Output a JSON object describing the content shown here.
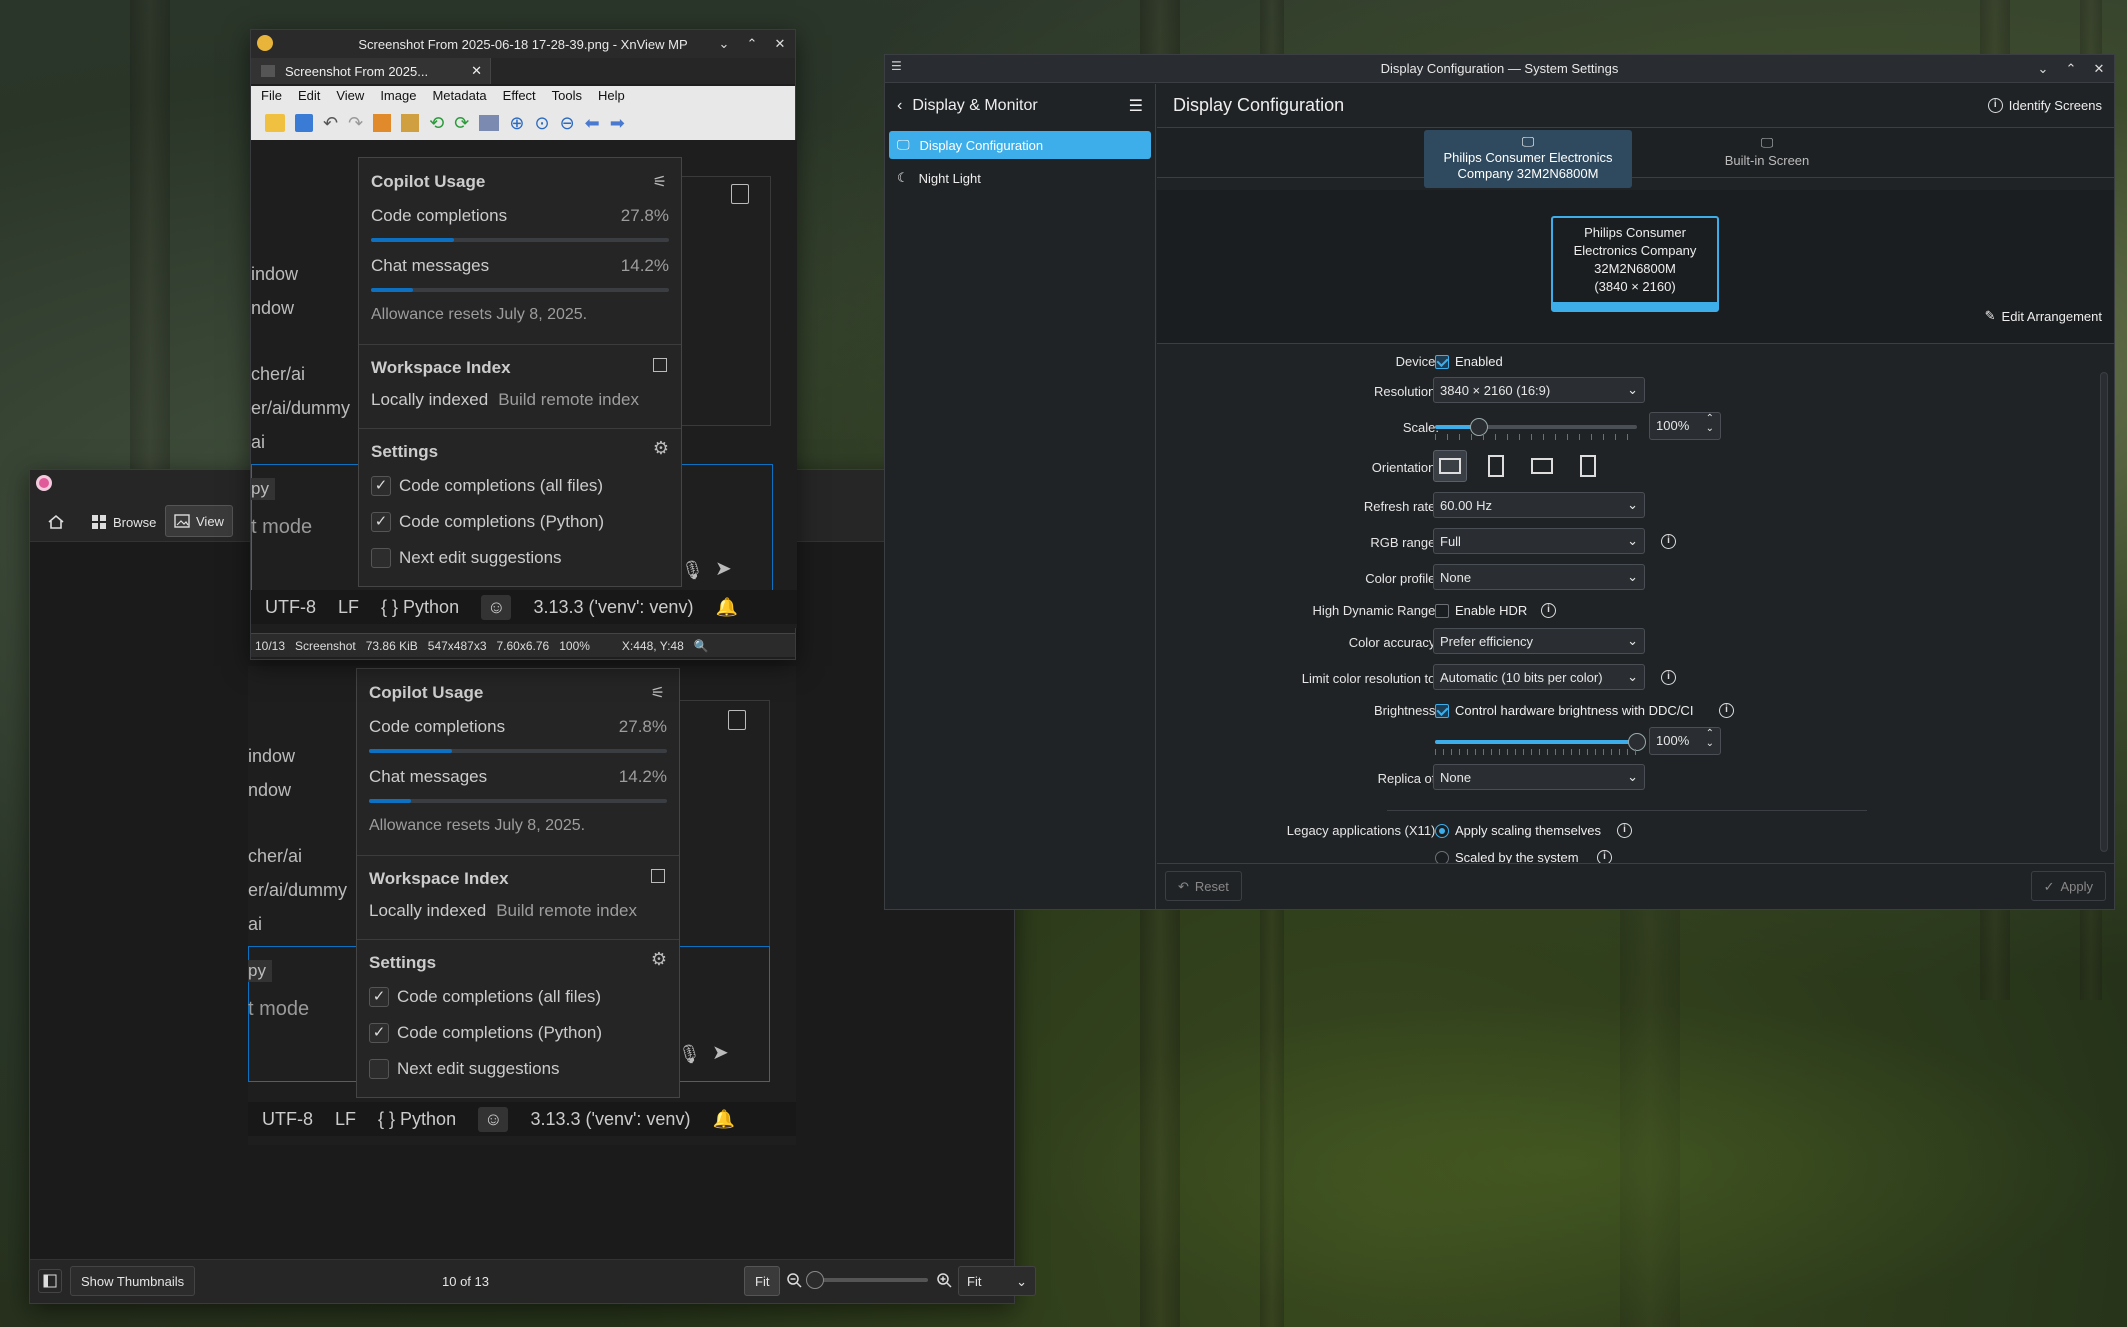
{
  "xnview": {
    "title": "Screenshot From 2025-06-18 17-28-39.png - XnView MP",
    "tab": "Screenshot From 2025...",
    "menu": [
      "File",
      "Edit",
      "View",
      "Image",
      "Metadata",
      "Effect",
      "Tools",
      "Help"
    ],
    "status": {
      "index": "10/13",
      "name": "Screenshot",
      "size": "73.86 KiB",
      "dims": "547x487x3",
      "print": "7.60x6.76",
      "zoom": "100%",
      "coords": "X:448, Y:48"
    }
  },
  "copilot": {
    "usage_title": "Copilot Usage",
    "code_label": "Code completions",
    "code_pct": "27.8%",
    "code_frac": 0.278,
    "chat_label": "Chat messages",
    "chat_pct": "14.2%",
    "chat_frac": 0.142,
    "reset": "Allowance resets July 8, 2025.",
    "workspace_title": "Workspace Index",
    "locally": "Locally indexed",
    "remote": "Build remote index",
    "settings_title": "Settings",
    "opt1": "Code completions (all files)",
    "opt2": "Code completions (Python)",
    "opt3": "Next edit suggestions"
  },
  "editor_bg": {
    "l1": "indow",
    "l2": "ndow",
    "l3": "cher/ai",
    "l4": "er/ai/dummy",
    "l5": "ai",
    "l6": "py",
    "l7": "t mode"
  },
  "vscode_status": {
    "enc": "UTF-8",
    "eol": "LF",
    "lang": "{ } Python",
    "py": "3.13.3 ('venv': venv)"
  },
  "viewer": {
    "browse": "Browse",
    "view": "View",
    "show_thumbs": "Show Thumbnails",
    "counter": "10 of 13",
    "fit_btn": "Fit",
    "fit_combo": "Fit"
  },
  "kde": {
    "title": "Display Configuration — System Settings",
    "back_title": "Display & Monitor",
    "nav": [
      "Display Configuration",
      "Night Light"
    ],
    "page_title": "Display Configuration",
    "identify": "Identify Screens",
    "screen_tab1": "Philips Consumer Electronics Company 32M2N6800M",
    "screen_tab2": "Built-in Screen",
    "monitor_name": "Philips Consumer Electronics Company 32M2N6800M",
    "monitor_res": "(3840 × 2160)",
    "edit_arrangement": "Edit Arrangement",
    "labels": {
      "device": "Device:",
      "resolution": "Resolution:",
      "scale": "Scale:",
      "orientation": "Orientation:",
      "refresh": "Refresh rate:",
      "rgb": "RGB range:",
      "profile": "Color profile:",
      "hdr": "High Dynamic Range:",
      "accuracy": "Color accuracy:",
      "limit": "Limit color resolution to:",
      "brightness": "Brightness:",
      "replica": "Replica of:",
      "legacy": "Legacy applications (X11):"
    },
    "values": {
      "enabled": "Enabled",
      "resolution": "3840 × 2160 (16:9)",
      "scale": "100%",
      "scale_frac": 0.22,
      "refresh": "60.00 Hz",
      "rgb": "Full",
      "profile": "None",
      "hdr": "Enable HDR",
      "accuracy": "Prefer efficiency",
      "limit": "Automatic (10 bits per color)",
      "brightness_ctl": "Control hardware brightness with DDC/CI",
      "brightness": "100%",
      "brightness_frac": 1.0,
      "replica": "None",
      "legacy1": "Apply scaling themselves",
      "legacy2": "Scaled by the system"
    },
    "reset": "Reset",
    "apply": "Apply"
  }
}
